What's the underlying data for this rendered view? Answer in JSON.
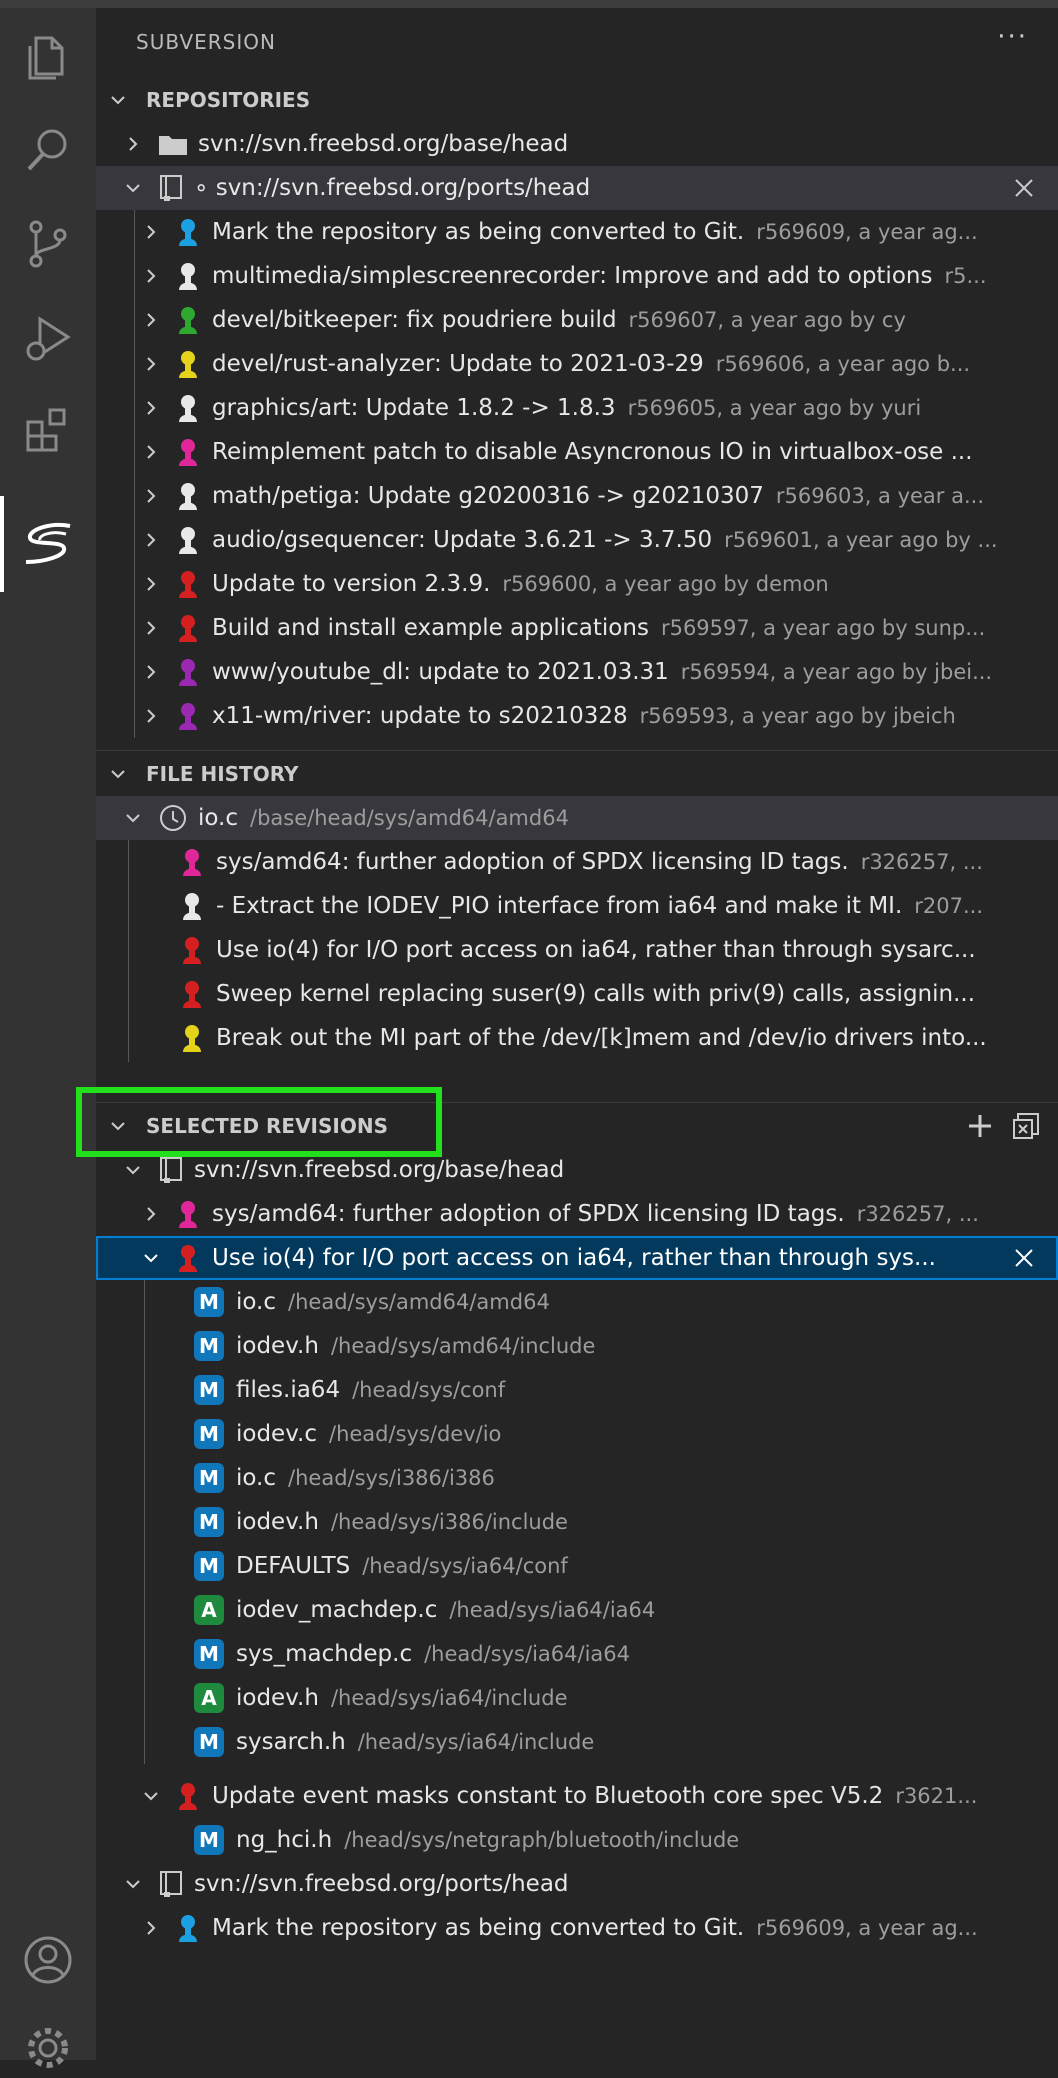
{
  "panel_title": "SUBVERSION",
  "more_actions": "···",
  "sections": {
    "repositories": "REPOSITORIES",
    "file_history": "FILE HISTORY",
    "selected_revisions": "SELECTED REVISIONS"
  },
  "repositories": {
    "base_repo": "svn://svn.freebsd.org/base/head",
    "ports_repo": "∘ svn://svn.freebsd.org/ports/head",
    "commits": [
      {
        "label": "Mark the repository as being converted to Git.",
        "desc": "r569609, a year ag...",
        "color": "#1ba1e2"
      },
      {
        "label": "multimedia/simplescreenrecorder: Improve and add to options",
        "desc": "r5...",
        "color": "#e8e8e8"
      },
      {
        "label": "devel/bitkeeper: fix poudriere build",
        "desc": "r569607, a year ago by cy",
        "color": "#2fa82f"
      },
      {
        "label": "devel/rust-analyzer: Update to 2021-03-29",
        "desc": "r569606, a year ago b...",
        "color": "#e5d21b"
      },
      {
        "label": "graphics/art: Update 1.8.2 -> 1.8.3",
        "desc": "r569605, a year ago by yuri",
        "color": "#e8e8e8"
      },
      {
        "label": "Reimplement patch to disable Asyncronous IO in virtualbox-ose ...",
        "desc": "",
        "color": "#e0279a"
      },
      {
        "label": "math/petiga: Update g20200316 -> g20210307",
        "desc": "r569603, a year a...",
        "color": "#e8e8e8"
      },
      {
        "label": "audio/gsequencer: Update 3.6.21 -> 3.7.50",
        "desc": "r569601, a year ago by ...",
        "color": "#e8e8e8"
      },
      {
        "label": "Update to version 2.3.9.",
        "desc": "r569600, a year ago by demon",
        "color": "#d42020"
      },
      {
        "label": "Build and install example applications",
        "desc": "r569597, a year ago by sunp...",
        "color": "#d42020"
      },
      {
        "label": "www/youtube_dl: update to 2021.03.31",
        "desc": "r569594, a year ago by jbei...",
        "color": "#9b28b0"
      },
      {
        "label": "x11-wm/river: update to s20210328",
        "desc": "r569593, a year ago by jbeich",
        "color": "#9b28b0"
      }
    ]
  },
  "file_history": {
    "file": "io.c",
    "path": "/base/head/sys/amd64/amd64",
    "commits": [
      {
        "label": "sys/amd64: further adoption of SPDX licensing ID tags.",
        "desc": "r326257, ...",
        "color": "#e0279a"
      },
      {
        "label": "- Extract the IODEV_PIO interface from ia64 and make it MI.",
        "desc": "r207...",
        "color": "#e8e8e8"
      },
      {
        "label": "Use io(4) for I/O port access on ia64, rather than through sysarc...",
        "desc": "",
        "color": "#d42020"
      },
      {
        "label": "Sweep kernel replacing suser(9) calls with priv(9) calls, assignin...",
        "desc": "",
        "color": "#d42020"
      },
      {
        "label": "Break out the MI part of the /dev/[k]mem and /dev/io drivers into...",
        "desc": "",
        "color": "#e5d21b"
      }
    ]
  },
  "selected_revisions": {
    "base_repo": "svn://svn.freebsd.org/base/head",
    "rev1": {
      "label": "sys/amd64: further adoption of SPDX licensing ID tags.",
      "desc": "r326257, ...",
      "color": "#e0279a"
    },
    "rev2": {
      "label": "Use io(4) for I/O port access on ia64, rather than through sys...",
      "color": "#d42020"
    },
    "files": [
      {
        "status": "M",
        "name": "io.c",
        "path": "/head/sys/amd64/amd64"
      },
      {
        "status": "M",
        "name": "iodev.h",
        "path": "/head/sys/amd64/include"
      },
      {
        "status": "M",
        "name": "files.ia64",
        "path": "/head/sys/conf"
      },
      {
        "status": "M",
        "name": "iodev.c",
        "path": "/head/sys/dev/io"
      },
      {
        "status": "M",
        "name": "io.c",
        "path": "/head/sys/i386/i386"
      },
      {
        "status": "M",
        "name": "iodev.h",
        "path": "/head/sys/i386/include"
      },
      {
        "status": "M",
        "name": "DEFAULTS",
        "path": "/head/sys/ia64/conf"
      },
      {
        "status": "A",
        "name": "iodev_machdep.c",
        "path": "/head/sys/ia64/ia64"
      },
      {
        "status": "M",
        "name": "sys_machdep.c",
        "path": "/head/sys/ia64/ia64"
      },
      {
        "status": "A",
        "name": "iodev.h",
        "path": "/head/sys/ia64/include"
      },
      {
        "status": "M",
        "name": "sysarch.h",
        "path": "/head/sys/ia64/include"
      }
    ],
    "rev3": {
      "label": "Update event masks constant to Bluetooth core spec V5.2",
      "desc": "r3621...",
      "color": "#d42020"
    },
    "rev3_file": {
      "status": "M",
      "name": "ng_hci.h",
      "path": "/head/sys/netgraph/bluetooth/include"
    },
    "ports_repo": "svn://svn.freebsd.org/ports/head",
    "ports_rev": {
      "label": "Mark the repository as being converted to Git.",
      "desc": "r569609, a year ag...",
      "color": "#1ba1e2"
    }
  },
  "colors": {
    "modified": "#1177bb",
    "added": "#1e8a3e",
    "selection": "#04395e",
    "focus_border": "#007fd4",
    "highlight": "#22e01c"
  },
  "icons": [
    "explorer-icon",
    "search-icon",
    "source-control-icon",
    "run-debug-icon",
    "extensions-icon",
    "svn-icon",
    "account-icon",
    "settings-icon"
  ]
}
